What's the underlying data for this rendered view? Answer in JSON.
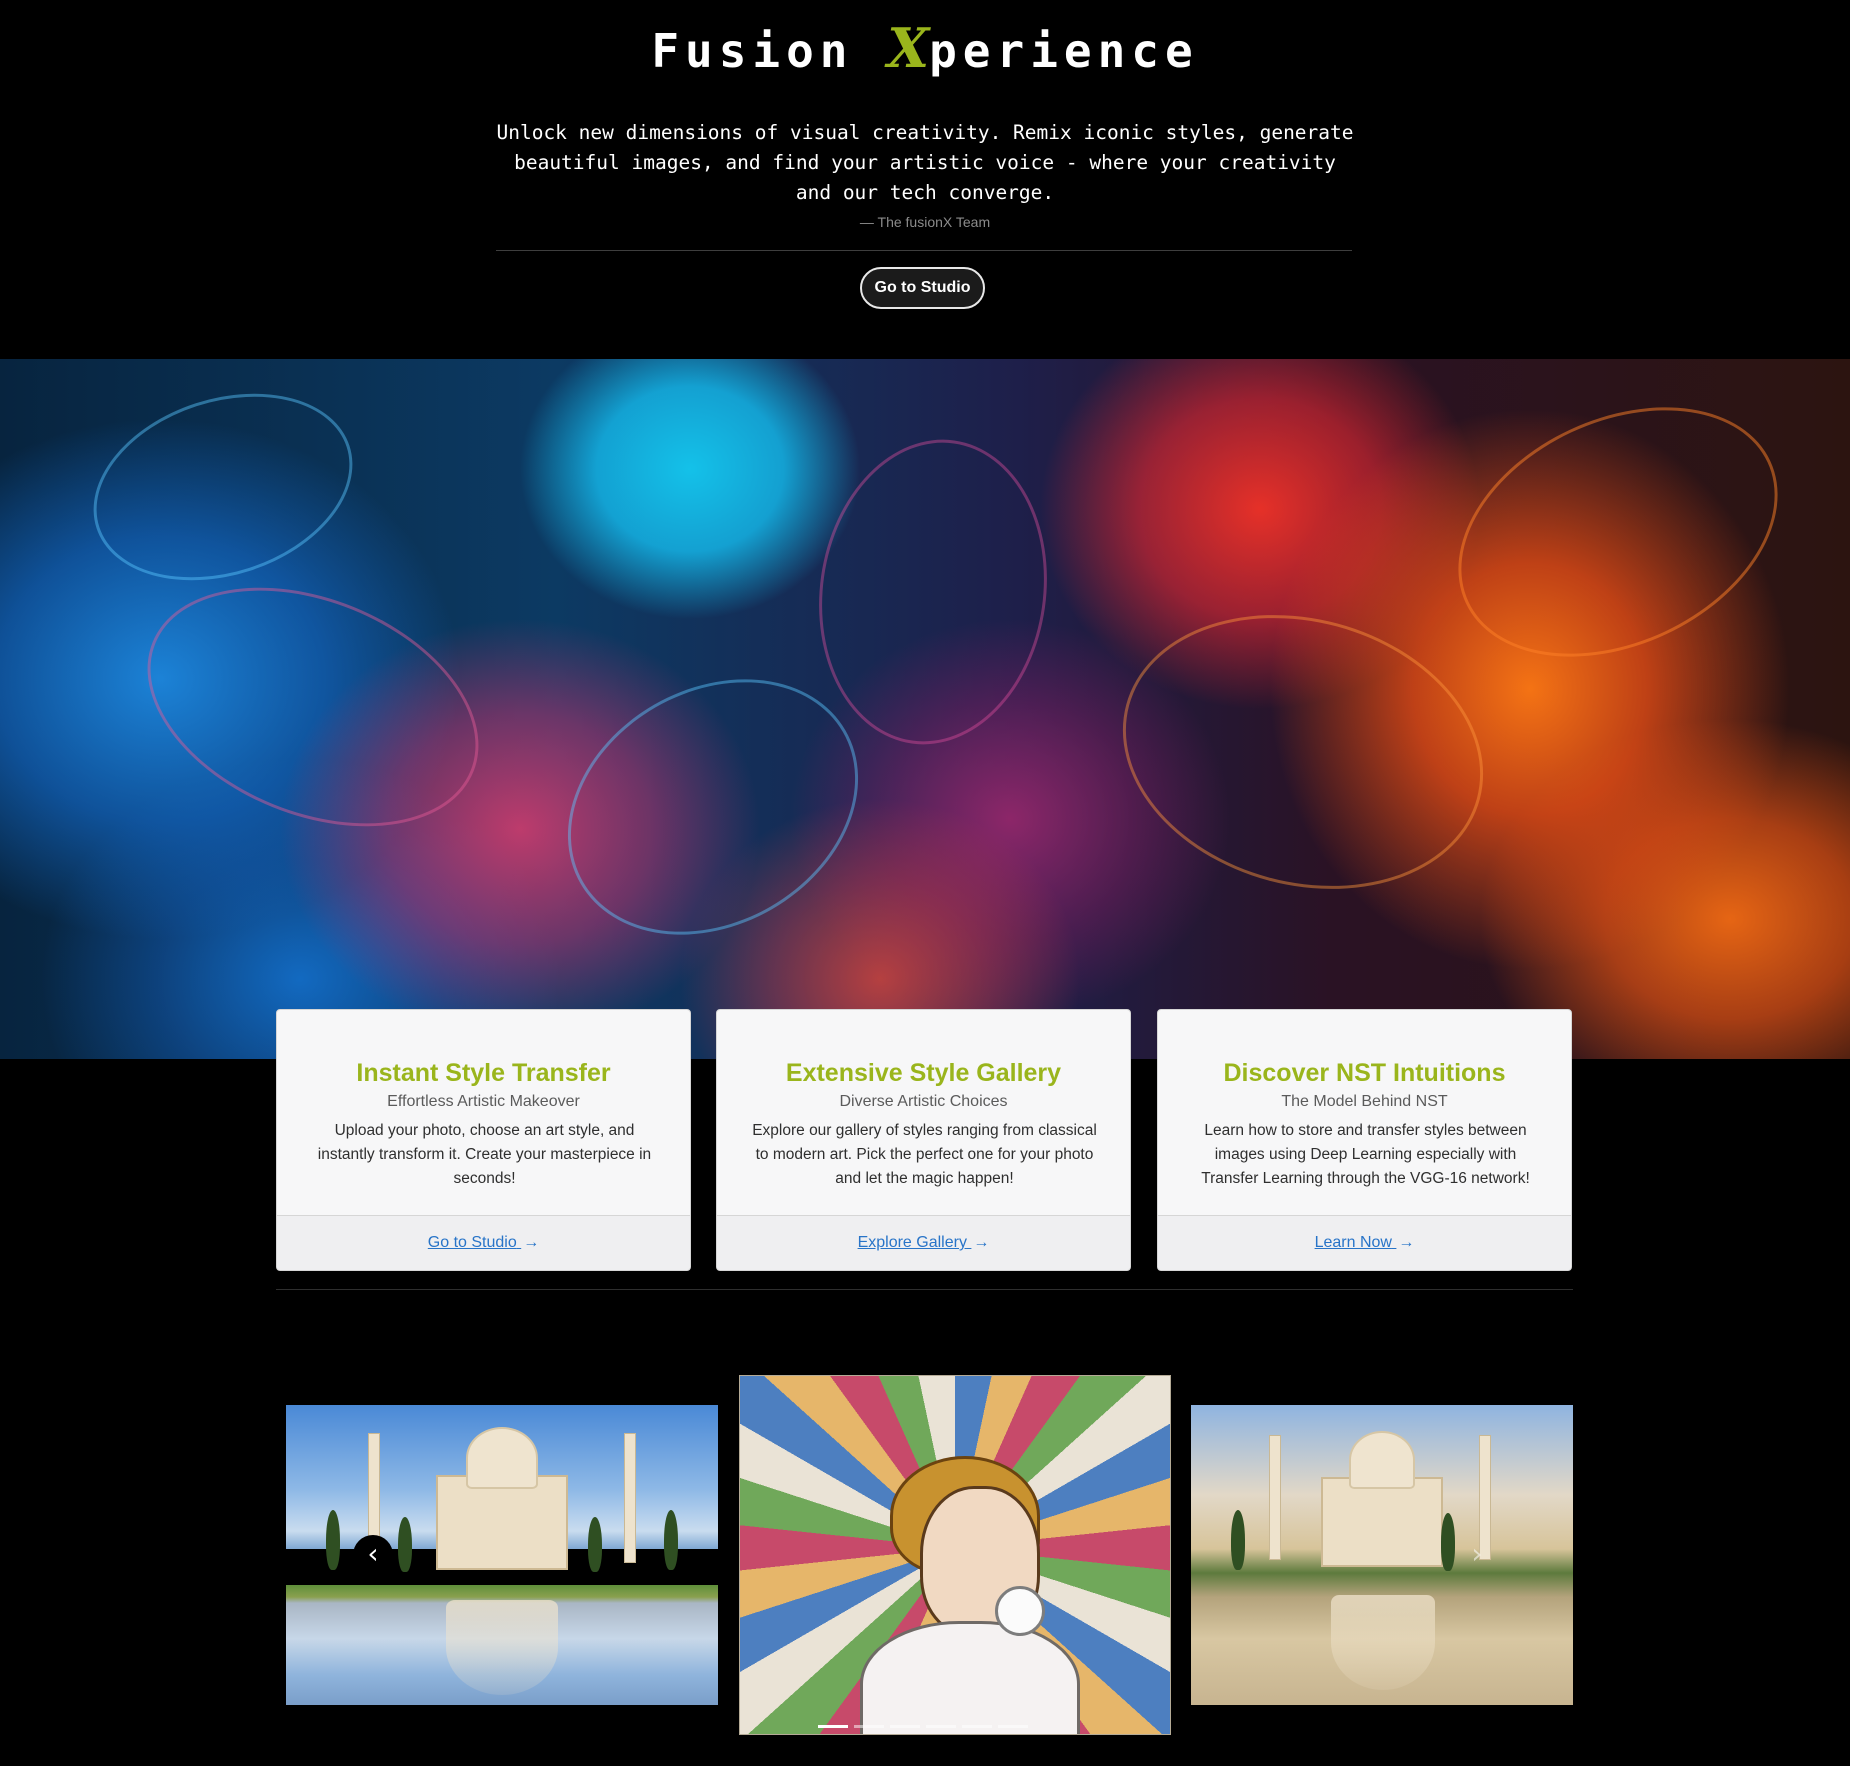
{
  "header": {
    "brand_before": "Fusion ",
    "brand_x": "X",
    "brand_after": "perience",
    "quote": "Unlock new dimensions of visual creativity. Remix iconic styles, generate beautiful images, and find your artistic voice - where your creativity and our tech converge.",
    "quote_author": "— The fusionX Team",
    "studio_button_label": "Go to Studio"
  },
  "cards": [
    {
      "title": "Instant Style Transfer",
      "subtitle": "Effortless Artistic Makeover",
      "text": "Upload your photo, choose an art style, and instantly transform it. Create your masterpiece in seconds!",
      "link_label": "Go to Studio",
      "link_arrow": "→"
    },
    {
      "title": "Extensive Style Gallery",
      "subtitle": "Diverse Artistic Choices",
      "text": "Explore our gallery of styles ranging from classical to modern art. Pick the perfect one for your photo and let the magic happen!",
      "link_label": "Explore Gallery",
      "link_arrow": "→"
    },
    {
      "title": "Discover NST Intuitions",
      "subtitle": "The Model Behind NST",
      "text": "Learn how to store and transfer styles between images using Deep Learning especially with Transfer Learning through the VGG-16 network!",
      "link_label": "Learn Now",
      "link_arrow": "→"
    }
  ],
  "carousel": {
    "prev_glyph": "‹",
    "next_glyph": "›",
    "slide_count": 6,
    "active_index": 0
  },
  "colors": {
    "accent": "#9ab51c",
    "link": "#2874c8",
    "background": "#000000",
    "card_background": "#f7f7f8"
  },
  "icons": {
    "prev": "chevron-left-icon",
    "next": "chevron-right-icon",
    "link_arrow": "arrow-right-icon"
  }
}
